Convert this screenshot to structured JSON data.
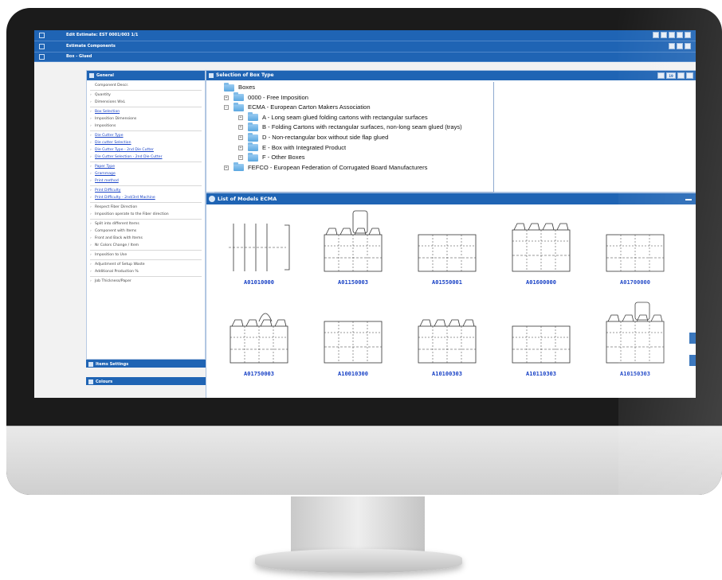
{
  "header": {
    "row1": "Edit Estimate: EST 0001/003 1/1",
    "row2": "Estimate Components",
    "row3": "Box - Glued"
  },
  "left_panel": {
    "title": "General",
    "items": [
      {
        "label": "Component Descr.",
        "link": false
      },
      {
        "label": "Quantity",
        "link": false
      },
      {
        "label": "Dimensions WxL",
        "link": false
      },
      {
        "label": "Box Selection",
        "link": true
      },
      {
        "label": "Imposition Dimensions",
        "link": false
      },
      {
        "label": "Impositions",
        "link": false
      },
      {
        "label": "Die Cutter Type",
        "link": true
      },
      {
        "label": "Die cutter Selection",
        "link": true
      },
      {
        "label": "Die Cutter Type - 2nd Die Cutter",
        "link": true
      },
      {
        "label": "Die Cutter Selection - 2nd Die Cutter",
        "link": true
      },
      {
        "label": "Paper Type",
        "link": true
      },
      {
        "label": "Grammage",
        "link": true
      },
      {
        "label": "Print method",
        "link": true
      },
      {
        "label": "Print Difficulty",
        "link": true
      },
      {
        "label": "Print Difficulty - 2nd/3rd Machine",
        "link": true
      },
      {
        "label": "Respect Fiber Direction",
        "link": false
      },
      {
        "label": "Imposition operate to the Fiber direction",
        "link": false
      },
      {
        "label": "Split into different Items",
        "link": false
      },
      {
        "label": "Component with Items",
        "link": false
      },
      {
        "label": "Front and Back with Items",
        "link": false
      },
      {
        "label": "Nr Colors Change / Item",
        "link": false
      },
      {
        "label": "Imposition to Use",
        "link": false
      },
      {
        "label": "Adjustment of Setup Waste",
        "link": false
      },
      {
        "label": "Additional Production %",
        "link": false
      },
      {
        "label": "Job Thickness/Paper",
        "link": false
      }
    ],
    "section2": "Items Settings",
    "section3": "Colours"
  },
  "selection_panel": {
    "title": "Selection of Box Type",
    "tree": [
      {
        "label": "Boxes",
        "level": 0
      },
      {
        "label": "0000 - Free Imposition",
        "level": 1
      },
      {
        "label": "ECMA - European Carton Makers Association",
        "level": 1
      },
      {
        "label": "A - Long seam glued folding cartons with rectangular surfaces",
        "level": 2
      },
      {
        "label": "B - Folding Cartons with rectangular surfaces, non-long seam glued (trays)",
        "level": 2
      },
      {
        "label": "D - Non-rectangular box without side flap glued",
        "level": 2
      },
      {
        "label": "E - Box with Integrated Product",
        "level": 2
      },
      {
        "label": "F - Other Boxes",
        "level": 2
      },
      {
        "label": "FEFCO - European Federation of Corrugated Board Manufacturers",
        "level": 1
      }
    ],
    "toolbar": [
      "19"
    ]
  },
  "models_panel": {
    "title": "List of Models ECMA",
    "models": [
      "A01010000",
      "A01150003",
      "A01550001",
      "A01600000",
      "A01700000",
      "A01750003",
      "A10010300",
      "A10100303",
      "A10110303",
      "A10150303"
    ]
  },
  "colors": {
    "accent": "#1f64b4",
    "link": "#1a43c6"
  }
}
